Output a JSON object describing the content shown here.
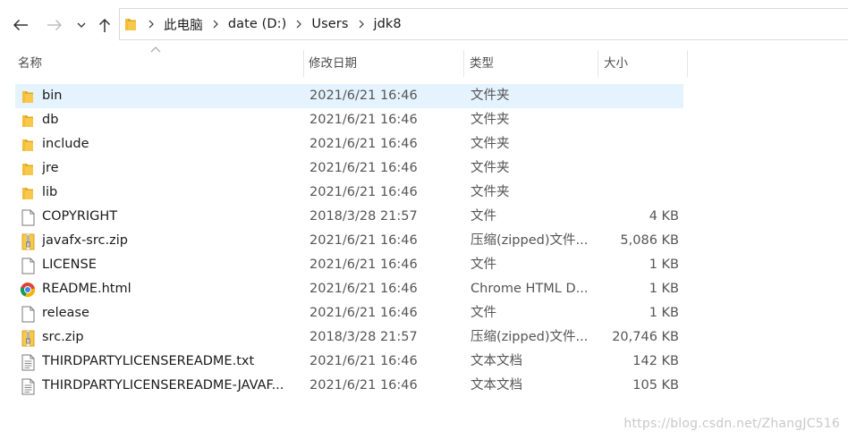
{
  "nav": {
    "back_icon": "arrow-left-icon",
    "forward_icon": "arrow-right-icon",
    "recent_icon": "chevron-down-icon",
    "up_icon": "arrow-up-icon"
  },
  "address": {
    "folder_icon": "folder-icon",
    "crumbs": [
      "此电脑",
      "date (D:)",
      "Users",
      "jdk8"
    ]
  },
  "columns": {
    "name": "名称",
    "date": "修改日期",
    "type": "类型",
    "size": "大小"
  },
  "files": [
    {
      "name": "bin",
      "date": "2021/6/21 16:46",
      "type": "文件夹",
      "size": "",
      "icon": "folder",
      "selected": true
    },
    {
      "name": "db",
      "date": "2021/6/21 16:46",
      "type": "文件夹",
      "size": "",
      "icon": "folder"
    },
    {
      "name": "include",
      "date": "2021/6/21 16:46",
      "type": "文件夹",
      "size": "",
      "icon": "folder"
    },
    {
      "name": "jre",
      "date": "2021/6/21 16:46",
      "type": "文件夹",
      "size": "",
      "icon": "folder"
    },
    {
      "name": "lib",
      "date": "2021/6/21 16:46",
      "type": "文件夹",
      "size": "",
      "icon": "folder"
    },
    {
      "name": "COPYRIGHT",
      "date": "2018/3/28 21:57",
      "type": "文件",
      "size": "4 KB",
      "icon": "file"
    },
    {
      "name": "javafx-src.zip",
      "date": "2021/6/21 16:46",
      "type": "压缩(zipped)文件...",
      "size": "5,086 KB",
      "icon": "zip"
    },
    {
      "name": "LICENSE",
      "date": "2021/6/21 16:46",
      "type": "文件",
      "size": "1 KB",
      "icon": "file"
    },
    {
      "name": "README.html",
      "date": "2021/6/21 16:46",
      "type": "Chrome HTML D...",
      "size": "1 KB",
      "icon": "chrome"
    },
    {
      "name": "release",
      "date": "2021/6/21 16:46",
      "type": "文件",
      "size": "1 KB",
      "icon": "file"
    },
    {
      "name": "src.zip",
      "date": "2018/3/28 21:57",
      "type": "压缩(zipped)文件...",
      "size": "20,746 KB",
      "icon": "zip"
    },
    {
      "name": "THIRDPARTYLICENSEREADME.txt",
      "date": "2021/6/21 16:46",
      "type": "文本文档",
      "size": "142 KB",
      "icon": "text"
    },
    {
      "name": "THIRDPARTYLICENSEREADME-JAVAF...",
      "date": "2021/6/21 16:46",
      "type": "文本文档",
      "size": "105 KB",
      "icon": "text"
    }
  ],
  "colors": {
    "selection": "#e5f3ff",
    "folder": "#f8c84a",
    "folder_dark": "#e0a823"
  },
  "watermark": "https://blog.csdn.net/ZhangJC516"
}
